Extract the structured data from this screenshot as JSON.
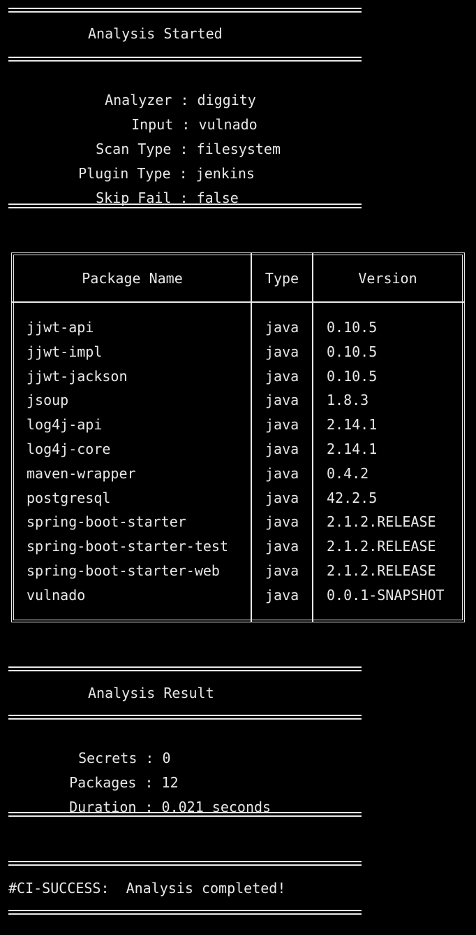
{
  "started": {
    "title": "Analysis Started",
    "fields": [
      {
        "key": "Analyzer",
        "value": "diggity"
      },
      {
        "key": "Input",
        "value": "vulnado"
      },
      {
        "key": "Scan Type",
        "value": "filesystem"
      },
      {
        "key": "Plugin Type",
        "value": "jenkins"
      },
      {
        "key": "Skip Fail",
        "value": "false"
      }
    ]
  },
  "table": {
    "headers": [
      "Package Name",
      "Type",
      "Version"
    ],
    "rows": [
      [
        "jjwt-api",
        "java",
        "0.10.5"
      ],
      [
        "jjwt-impl",
        "java",
        "0.10.5"
      ],
      [
        "jjwt-jackson",
        "java",
        "0.10.5"
      ],
      [
        "jsoup",
        "java",
        "1.8.3"
      ],
      [
        "log4j-api",
        "java",
        "2.14.1"
      ],
      [
        "log4j-core",
        "java",
        "2.14.1"
      ],
      [
        "maven-wrapper",
        "java",
        "0.4.2"
      ],
      [
        "postgresql",
        "java",
        "42.2.5"
      ],
      [
        "spring-boot-starter",
        "java",
        "2.1.2.RELEASE"
      ],
      [
        "spring-boot-starter-test",
        "java",
        "2.1.2.RELEASE"
      ],
      [
        "spring-boot-starter-web",
        "java",
        "2.1.2.RELEASE"
      ],
      [
        "vulnado",
        "java",
        "0.0.1-SNAPSHOT"
      ]
    ]
  },
  "result": {
    "title": "Analysis Result",
    "fields": [
      {
        "key": "Secrets",
        "value": "0"
      },
      {
        "key": "Packages",
        "value": "12"
      },
      {
        "key": "Duration",
        "value": "0.021 seconds"
      }
    ]
  },
  "final": {
    "message": "#CI-SUCCESS:  Analysis completed!"
  },
  "colors": {
    "background": "#000000",
    "text": "#e8e8e8"
  }
}
